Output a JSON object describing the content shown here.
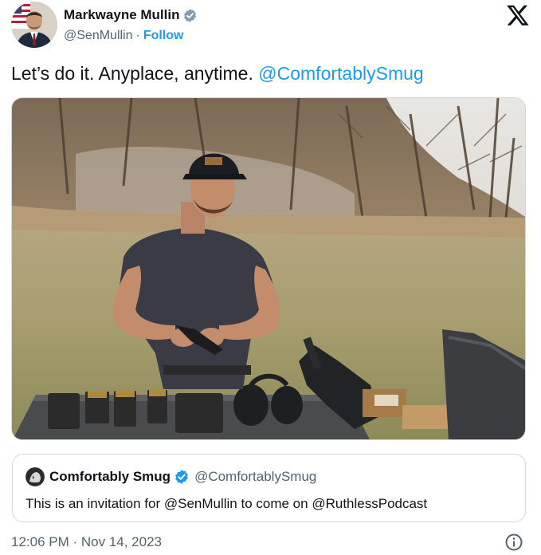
{
  "author": {
    "display_name": "Markwayne Mullin",
    "handle": "@SenMullin",
    "separator": "·",
    "follow_label": "Follow"
  },
  "tweet": {
    "text": "Let’s do it. Anyplace, anytime.",
    "mention": "@ComfortablySmug"
  },
  "quote": {
    "display_name": "Comfortably Smug",
    "handle": "@ComfortablySmug",
    "text_before": "This is an invitation for ",
    "mention_1": "@SenMullin",
    "text_middle": " to come on ",
    "mention_2": "@RuthlessPodcast"
  },
  "footer": {
    "timestamp": "12:06 PM · Nov 14, 2023"
  },
  "icons": {
    "verified": "verified-badge-icon",
    "x_logo": "x-logo-icon",
    "info": "info-icon"
  },
  "colors": {
    "link": "#1d9bf0",
    "secondary_text": "#536471",
    "border": "#cfd9de"
  }
}
